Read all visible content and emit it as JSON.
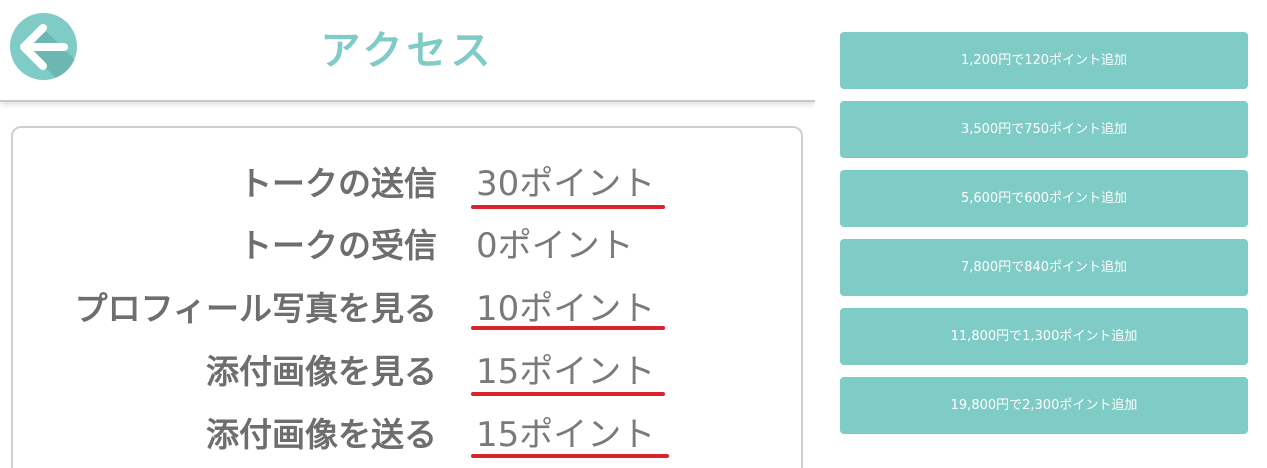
{
  "header": {
    "title": "アクセス",
    "back_icon": "arrow-left-icon"
  },
  "costs": [
    {
      "label": "トークの送信",
      "value": "30ポイント",
      "underlined": true
    },
    {
      "label": "トークの受信",
      "value": "0ポイント",
      "underlined": false
    },
    {
      "label": "プロフィール写真を見る",
      "value": "10ポイント",
      "underlined": true
    },
    {
      "label": "添付画像を見る",
      "value": "15ポイント",
      "underlined": true
    },
    {
      "label": "添付画像を送る",
      "value": "15ポイント",
      "underlined": true
    }
  ],
  "plans": [
    {
      "label": "1,200円で120ポイント追加"
    },
    {
      "label": "3,500円で750ポイント追加"
    },
    {
      "label": "5,600円で600ポイント追加"
    },
    {
      "label": "7,800円で840ポイント追加"
    },
    {
      "label": "11,800円で1,300ポイント追加"
    },
    {
      "label": "19,800円で2,300ポイント追加"
    }
  ],
  "colors": {
    "accent": "#7fcbc5",
    "underline": "#d9232e",
    "label_text": "#6e6e6e",
    "value_text": "#7a7a7a"
  }
}
